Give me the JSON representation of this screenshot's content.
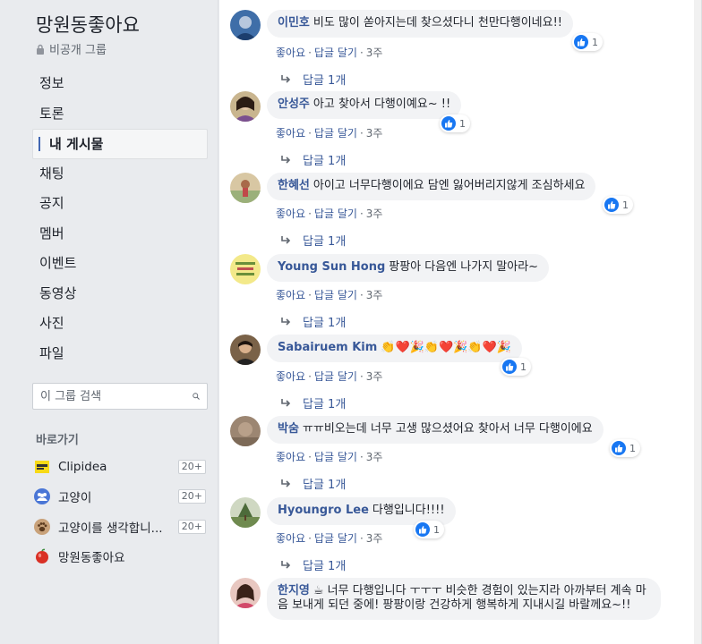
{
  "group": {
    "title": "망원동좋아요",
    "privacy": "비공개 그룹"
  },
  "nav": [
    {
      "label": "정보",
      "active": false
    },
    {
      "label": "토론",
      "active": false
    },
    {
      "label": "내 게시물",
      "active": true
    },
    {
      "label": "채팅",
      "active": false
    },
    {
      "label": "공지",
      "active": false
    },
    {
      "label": "멤버",
      "active": false
    },
    {
      "label": "이벤트",
      "active": false
    },
    {
      "label": "동영상",
      "active": false
    },
    {
      "label": "사진",
      "active": false
    },
    {
      "label": "파일",
      "active": false
    }
  ],
  "search": {
    "placeholder": "이 그룹 검색"
  },
  "shortcuts": {
    "title": "바로가기",
    "items": [
      {
        "label": "Clipidea",
        "badge": "20+",
        "icon": "clipidea-logo-icon"
      },
      {
        "label": "고양이",
        "badge": "20+",
        "icon": "group-icon"
      },
      {
        "label": "고양이를 생각합니...",
        "badge": "20+",
        "icon": "paw-icon"
      },
      {
        "label": "망원동좋아요",
        "badge": "",
        "icon": "apple-icon"
      }
    ]
  },
  "comment_actions": {
    "like": "좋아요",
    "reply": "답글 달기",
    "separator": "·"
  },
  "comments": [
    {
      "author": "이민호",
      "text": "비도 많이 쏟아지는데 찾으셨다니 천만다행이네요!!",
      "time": "3주",
      "likes": "1",
      "replies": "답글 1개"
    },
    {
      "author": "안성주",
      "text": "아고 찾아서 다행이예요~ !!",
      "time": "3주",
      "likes": "1",
      "replies": "답글 1개"
    },
    {
      "author": "한혜선",
      "text": "아이고 너무다행이에요 담엔 잃어버리지않게 조심하세요",
      "time": "3주",
      "likes": "1",
      "replies": "답글 1개"
    },
    {
      "author": "Young Sun Hong",
      "text": "팡팡아 다음엔 나가지 말아라~",
      "time": "3주",
      "likes": "",
      "replies": "답글 1개"
    },
    {
      "author": "Sabairuem Kim",
      "text": "👏❤️🎉👏❤️🎉👏❤️🎉",
      "time": "3주",
      "likes": "1",
      "replies": "답글 1개"
    },
    {
      "author": "박숨",
      "text": "ㅠㅠ비오는데 너무 고생 많으셨어요 찾아서 너무 다행이에요",
      "time": "3주",
      "likes": "1",
      "replies": "답글 1개"
    },
    {
      "author": "Hyoungro Lee",
      "text": "다행입니다!!!!",
      "time": "3주",
      "likes": "1",
      "replies": "답글 1개"
    },
    {
      "author": "한지영",
      "text": "☕ 너무 다행입니다 ㅜㅜㅜ 비슷한 경험이 있는지라 아까부터 계속 마음 보내게 되던 중에! 팡팡이랑 건강하게 행복하게 지내시길 바랄께요~!!",
      "time": "",
      "likes": "",
      "replies": ""
    }
  ],
  "colors": {
    "link": "#385898",
    "like_blue": "#1877f2",
    "bubble": "#f2f3f5",
    "sidebar_bg": "#e9ebee"
  }
}
